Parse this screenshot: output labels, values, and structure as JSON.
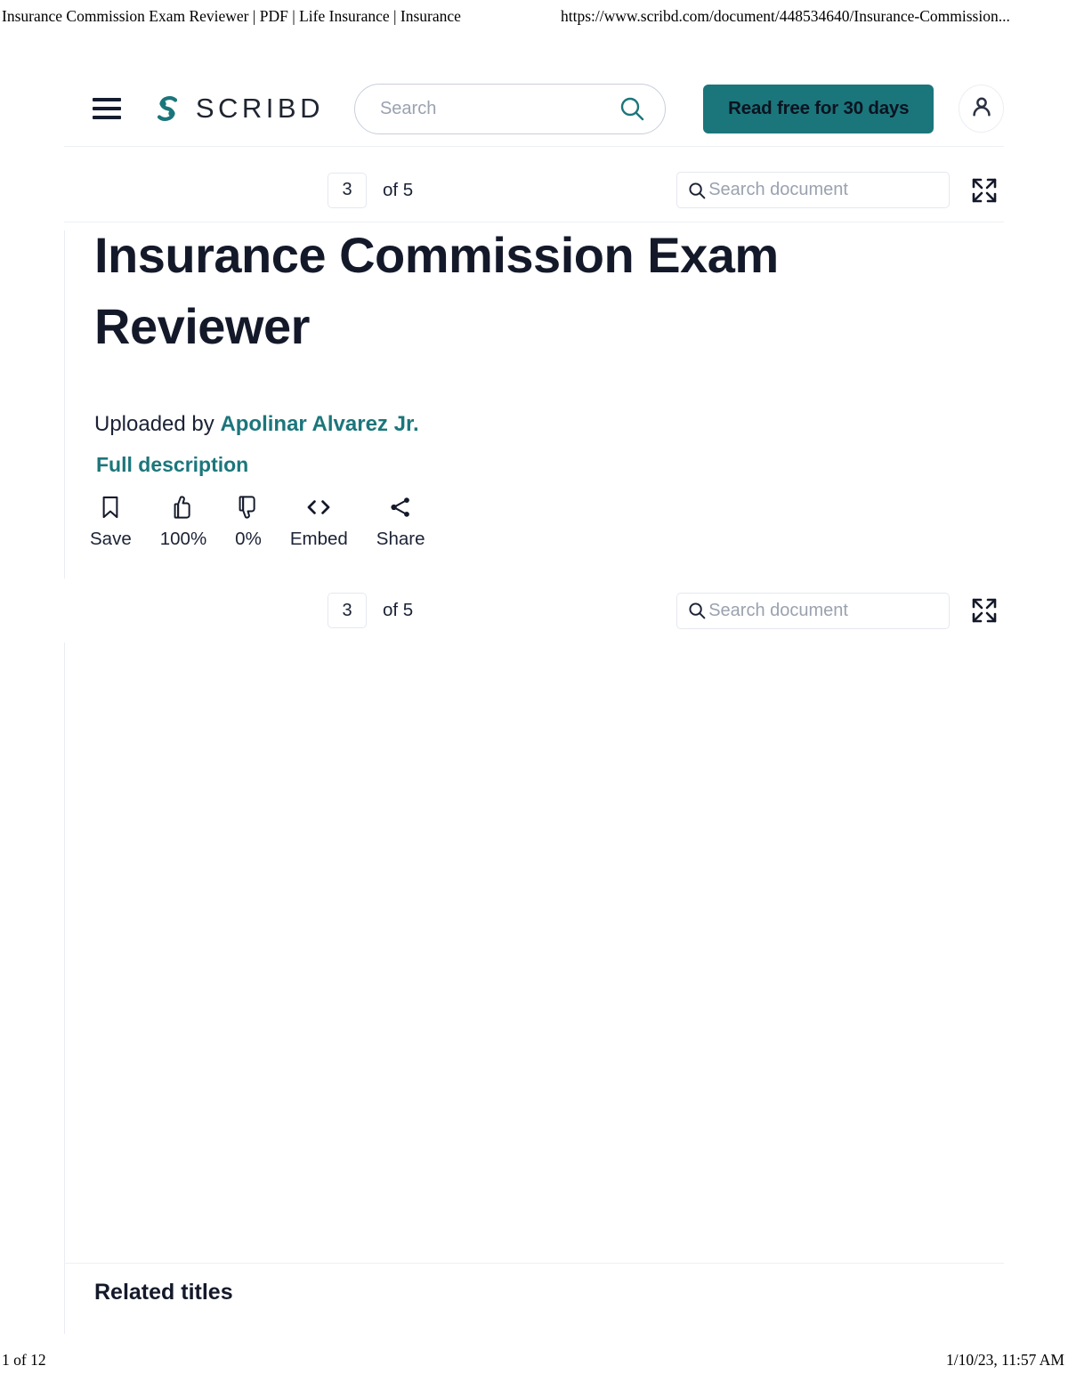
{
  "print": {
    "header_title": "Insurance Commission Exam Reviewer | PDF | Life Insurance | Insurance",
    "header_url": "https://www.scribd.com/document/448534640/Insurance-Commission...",
    "footer_page": "1 of 12",
    "footer_timestamp": "1/10/23, 11:57 AM"
  },
  "header": {
    "menu_icon": "hamburger-icon",
    "brand_name": "SCRIBD",
    "brand_logo_icon": "scribd-s-logo-icon",
    "search_placeholder": "Search",
    "search_value": "",
    "search_icon": "search-icon",
    "cta_label": "Read free for 30 days",
    "account_icon": "user-icon"
  },
  "toolbar": {
    "page_number": "3",
    "page_total": "of 5",
    "doc_search_placeholder": "Search document",
    "doc_search_value": "",
    "doc_search_icon": "search-icon",
    "fullscreen_icon": "fullscreen-expand-icon"
  },
  "document": {
    "title": "Insurance Commission Exam Reviewer",
    "uploaded_by_prefix": "Uploaded by",
    "uploader_name": "Apolinar Alvarez Jr.",
    "full_description_label": "Full description"
  },
  "actions": [
    {
      "icon": "bookmark-icon",
      "label": "Save"
    },
    {
      "icon": "thumbs-up-icon",
      "label": "100%"
    },
    {
      "icon": "thumbs-down-icon",
      "label": "0%"
    },
    {
      "icon": "code-brackets-icon",
      "label": "Embed"
    },
    {
      "icon": "share-icon",
      "label": "Share"
    }
  ],
  "related": {
    "heading": "Related titles"
  },
  "colors": {
    "teal": "#1b767b",
    "navy": "#14192a",
    "border": "#e4e8ef"
  }
}
